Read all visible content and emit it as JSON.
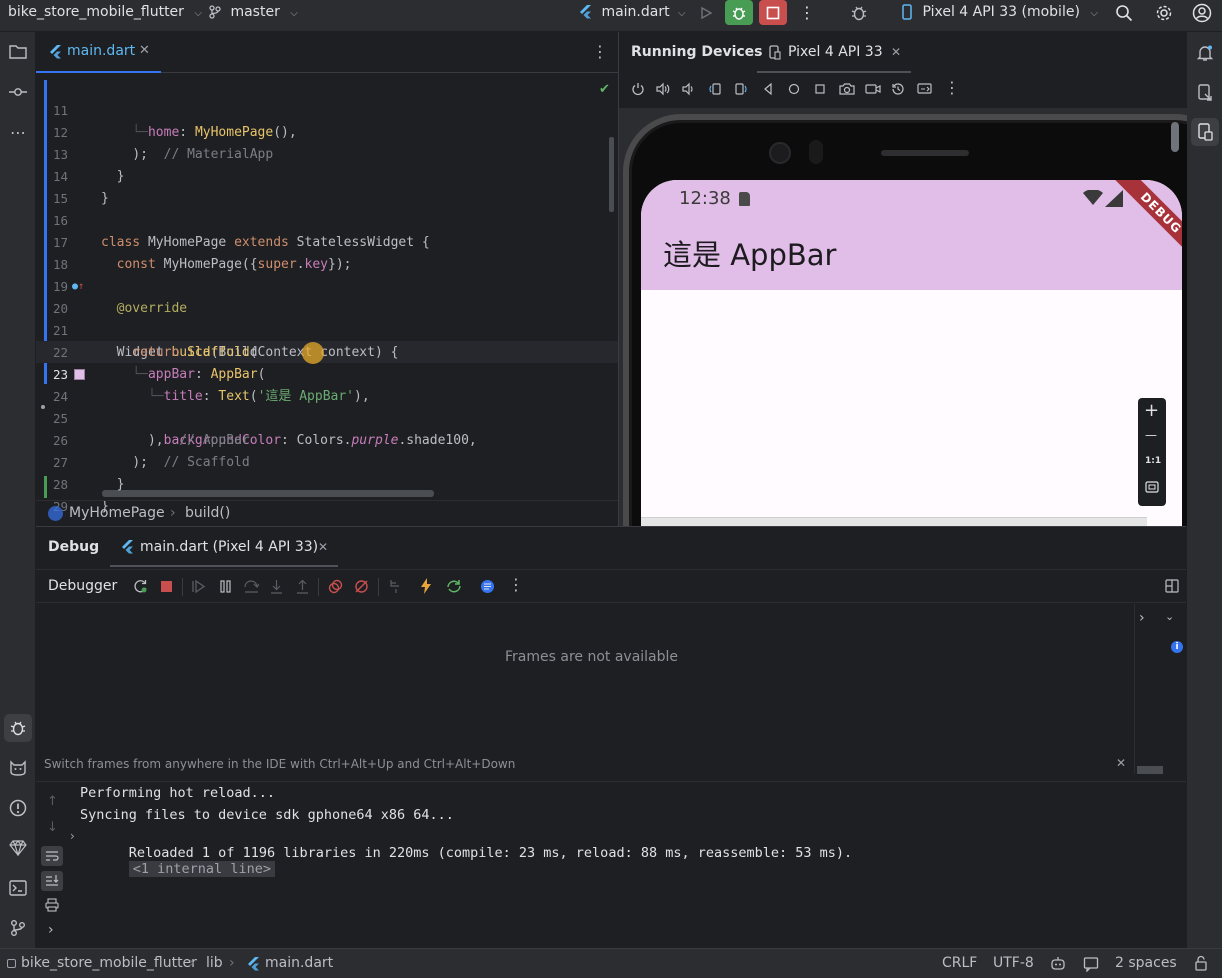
{
  "titlebar": {
    "project": "bike_store_mobile_flutter",
    "branch": "master",
    "run_config": "main.dart",
    "device": "Pixel 4 API 33 (mobile)"
  },
  "editor": {
    "tab_label": "main.dart",
    "lines": [
      {
        "n": "11"
      },
      {
        "n": "12"
      },
      {
        "n": "13"
      },
      {
        "n": "14"
      },
      {
        "n": "15"
      },
      {
        "n": "16"
      },
      {
        "n": "17"
      },
      {
        "n": "18"
      },
      {
        "n": "19"
      },
      {
        "n": "20"
      },
      {
        "n": "21"
      },
      {
        "n": "22"
      },
      {
        "n": "23"
      },
      {
        "n": "24"
      },
      {
        "n": "25"
      },
      {
        "n": "26"
      },
      {
        "n": "27"
      },
      {
        "n": "28"
      },
      {
        "n": "29"
      }
    ],
    "code": {
      "l11_a": "home",
      "l11_b": ": ",
      "l11_c": "MyHomePage",
      "l11_d": "(),",
      "l12_a": ");",
      "l12_b": "  // MaterialApp",
      "l13": "}",
      "l14": "}",
      "l16_a": "class",
      "l16_b": " MyHomePage ",
      "l16_c": "extends",
      "l16_d": " StatelessWidget {",
      "l17_a": "const",
      "l17_b": " MyHomePage({",
      "l17_c": "super",
      "l17_d": ".",
      "l17_e": "key",
      "l17_f": "});",
      "l19": "@override",
      "l20_a": "Widget ",
      "l20_b": "build",
      "l20_c": "(BuildContext context) {",
      "l21_a": "return",
      "l21_b": " Scaffold",
      "l21_c": "(",
      "l22_a": "appBar",
      "l22_b": ": ",
      "l22_c": "AppBar",
      "l22_d": "(",
      "l23_a": "title",
      "l23_b": ": ",
      "l23_c": "Text",
      "l23_d": "(",
      "l23_e": "'這是 AppBar'",
      "l23_f": "),",
      "l24_a": "backgroundColor",
      "l24_b": ": Colors.",
      "l24_c": "purple",
      "l24_d": ".shade100,",
      "l25_a": "),",
      "l25_b": "  // AppBar",
      "l26_a": ");",
      "l26_b": "  // Scaffold",
      "l27": "}",
      "l28": "}"
    },
    "breadcrumb": [
      "MyHomePage",
      "build()"
    ]
  },
  "devices": {
    "tab_running": "Running Devices",
    "tab_device": "Pixel 4 API 33",
    "phone": {
      "time": "12:38",
      "appbar_title": "這是 AppBar",
      "debug_banner": "DEBUG",
      "appbar_color": "#e1bee7"
    },
    "zoom": {
      "plus": "+",
      "minus": "—",
      "one_to_one": "1:1"
    }
  },
  "debug": {
    "tab_debug": "Debug",
    "tab_session": "main.dart (Pixel 4 API 33)",
    "debugger_label": "Debugger",
    "frames_empty": "Frames are not available",
    "hint": "Switch frames from anywhere in the IDE with Ctrl+Alt+Up and Ctrl+Alt+Down",
    "console": [
      "Performing hot reload...",
      "Syncing files to device sdk gphone64 x86 64...",
      "Reloaded 1 of 1196 libraries in 220ms (compile: 23 ms, reload: 88 ms, reassemble: 53 ms)."
    ],
    "internal_line": "<1 internal line>"
  },
  "statusbar": {
    "path": [
      "bike_store_mobile_flutter",
      "lib",
      "main.dart"
    ],
    "line_ending": "CRLF",
    "encoding": "UTF-8",
    "indent": "2 spaces"
  }
}
